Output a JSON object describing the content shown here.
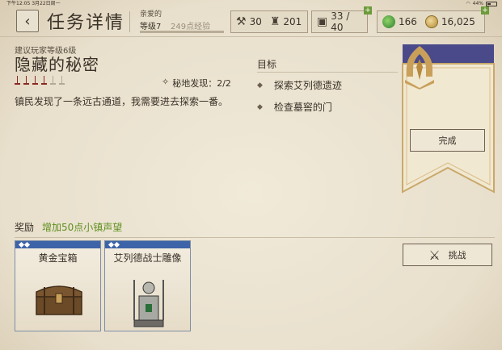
{
  "statusbar": {
    "time_date": "下午12:05  3月22日周一",
    "battery": "44%"
  },
  "header": {
    "back_icon": "back-arrow-icon",
    "title": "任务详情",
    "npc": {
      "name": "亲爱的",
      "level": "等级7",
      "exp_text": "249点经验",
      "exp_progress": 0.0
    },
    "resources": {
      "tools": "30",
      "armor": "201",
      "capacity": "33 / 40",
      "gems": "166",
      "gold": "16,025"
    }
  },
  "quest": {
    "suggested_level": "建议玩家等级6级",
    "title": "隐藏的秘密",
    "difficulty": 4,
    "difficulty_max": 6,
    "secret_label": "秘地发现：2/2",
    "description": "镇民发现了一条远古通道，我需要进去探索一番。"
  },
  "objectives": {
    "title": "目标",
    "items": [
      "探索艾列德遗迹",
      "检查墓窖的门"
    ]
  },
  "banner": {
    "complete_label": "完成",
    "emblem_icon": "guild-emblem-icon"
  },
  "rewards": {
    "label": "奖励",
    "bonus": "增加50点小镇声望",
    "items": [
      {
        "name": "黄金宝箱",
        "icon": "chest-icon"
      },
      {
        "name": "艾列德战士雕像",
        "icon": "statue-icon"
      }
    ]
  },
  "actions": {
    "challenge_label": "挑战",
    "challenge_icon": "crossed-axes-icon"
  },
  "colors": {
    "background": "#ece4d3",
    "banner_top": "#4a4a8a",
    "accent_green": "#5e8f1e",
    "card_border_blue": "#3d63a8",
    "difficulty_red": "#8a2a22"
  }
}
